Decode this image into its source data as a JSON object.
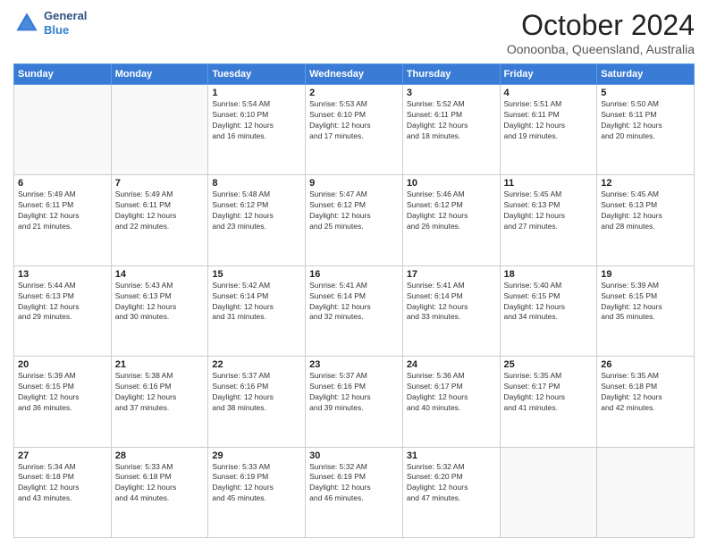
{
  "header": {
    "logo_line1": "General",
    "logo_line2": "Blue",
    "month": "October 2024",
    "location": "Oonoonba, Queensland, Australia"
  },
  "weekdays": [
    "Sunday",
    "Monday",
    "Tuesday",
    "Wednesday",
    "Thursday",
    "Friday",
    "Saturday"
  ],
  "weeks": [
    [
      {
        "day": "",
        "info": ""
      },
      {
        "day": "",
        "info": ""
      },
      {
        "day": "1",
        "info": "Sunrise: 5:54 AM\nSunset: 6:10 PM\nDaylight: 12 hours\nand 16 minutes."
      },
      {
        "day": "2",
        "info": "Sunrise: 5:53 AM\nSunset: 6:10 PM\nDaylight: 12 hours\nand 17 minutes."
      },
      {
        "day": "3",
        "info": "Sunrise: 5:52 AM\nSunset: 6:11 PM\nDaylight: 12 hours\nand 18 minutes."
      },
      {
        "day": "4",
        "info": "Sunrise: 5:51 AM\nSunset: 6:11 PM\nDaylight: 12 hours\nand 19 minutes."
      },
      {
        "day": "5",
        "info": "Sunrise: 5:50 AM\nSunset: 6:11 PM\nDaylight: 12 hours\nand 20 minutes."
      }
    ],
    [
      {
        "day": "6",
        "info": "Sunrise: 5:49 AM\nSunset: 6:11 PM\nDaylight: 12 hours\nand 21 minutes."
      },
      {
        "day": "7",
        "info": "Sunrise: 5:49 AM\nSunset: 6:11 PM\nDaylight: 12 hours\nand 22 minutes."
      },
      {
        "day": "8",
        "info": "Sunrise: 5:48 AM\nSunset: 6:12 PM\nDaylight: 12 hours\nand 23 minutes."
      },
      {
        "day": "9",
        "info": "Sunrise: 5:47 AM\nSunset: 6:12 PM\nDaylight: 12 hours\nand 25 minutes."
      },
      {
        "day": "10",
        "info": "Sunrise: 5:46 AM\nSunset: 6:12 PM\nDaylight: 12 hours\nand 26 minutes."
      },
      {
        "day": "11",
        "info": "Sunrise: 5:45 AM\nSunset: 6:13 PM\nDaylight: 12 hours\nand 27 minutes."
      },
      {
        "day": "12",
        "info": "Sunrise: 5:45 AM\nSunset: 6:13 PM\nDaylight: 12 hours\nand 28 minutes."
      }
    ],
    [
      {
        "day": "13",
        "info": "Sunrise: 5:44 AM\nSunset: 6:13 PM\nDaylight: 12 hours\nand 29 minutes."
      },
      {
        "day": "14",
        "info": "Sunrise: 5:43 AM\nSunset: 6:13 PM\nDaylight: 12 hours\nand 30 minutes."
      },
      {
        "day": "15",
        "info": "Sunrise: 5:42 AM\nSunset: 6:14 PM\nDaylight: 12 hours\nand 31 minutes."
      },
      {
        "day": "16",
        "info": "Sunrise: 5:41 AM\nSunset: 6:14 PM\nDaylight: 12 hours\nand 32 minutes."
      },
      {
        "day": "17",
        "info": "Sunrise: 5:41 AM\nSunset: 6:14 PM\nDaylight: 12 hours\nand 33 minutes."
      },
      {
        "day": "18",
        "info": "Sunrise: 5:40 AM\nSunset: 6:15 PM\nDaylight: 12 hours\nand 34 minutes."
      },
      {
        "day": "19",
        "info": "Sunrise: 5:39 AM\nSunset: 6:15 PM\nDaylight: 12 hours\nand 35 minutes."
      }
    ],
    [
      {
        "day": "20",
        "info": "Sunrise: 5:39 AM\nSunset: 6:15 PM\nDaylight: 12 hours\nand 36 minutes."
      },
      {
        "day": "21",
        "info": "Sunrise: 5:38 AM\nSunset: 6:16 PM\nDaylight: 12 hours\nand 37 minutes."
      },
      {
        "day": "22",
        "info": "Sunrise: 5:37 AM\nSunset: 6:16 PM\nDaylight: 12 hours\nand 38 minutes."
      },
      {
        "day": "23",
        "info": "Sunrise: 5:37 AM\nSunset: 6:16 PM\nDaylight: 12 hours\nand 39 minutes."
      },
      {
        "day": "24",
        "info": "Sunrise: 5:36 AM\nSunset: 6:17 PM\nDaylight: 12 hours\nand 40 minutes."
      },
      {
        "day": "25",
        "info": "Sunrise: 5:35 AM\nSunset: 6:17 PM\nDaylight: 12 hours\nand 41 minutes."
      },
      {
        "day": "26",
        "info": "Sunrise: 5:35 AM\nSunset: 6:18 PM\nDaylight: 12 hours\nand 42 minutes."
      }
    ],
    [
      {
        "day": "27",
        "info": "Sunrise: 5:34 AM\nSunset: 6:18 PM\nDaylight: 12 hours\nand 43 minutes."
      },
      {
        "day": "28",
        "info": "Sunrise: 5:33 AM\nSunset: 6:18 PM\nDaylight: 12 hours\nand 44 minutes."
      },
      {
        "day": "29",
        "info": "Sunrise: 5:33 AM\nSunset: 6:19 PM\nDaylight: 12 hours\nand 45 minutes."
      },
      {
        "day": "30",
        "info": "Sunrise: 5:32 AM\nSunset: 6:19 PM\nDaylight: 12 hours\nand 46 minutes."
      },
      {
        "day": "31",
        "info": "Sunrise: 5:32 AM\nSunset: 6:20 PM\nDaylight: 12 hours\nand 47 minutes."
      },
      {
        "day": "",
        "info": ""
      },
      {
        "day": "",
        "info": ""
      }
    ]
  ]
}
